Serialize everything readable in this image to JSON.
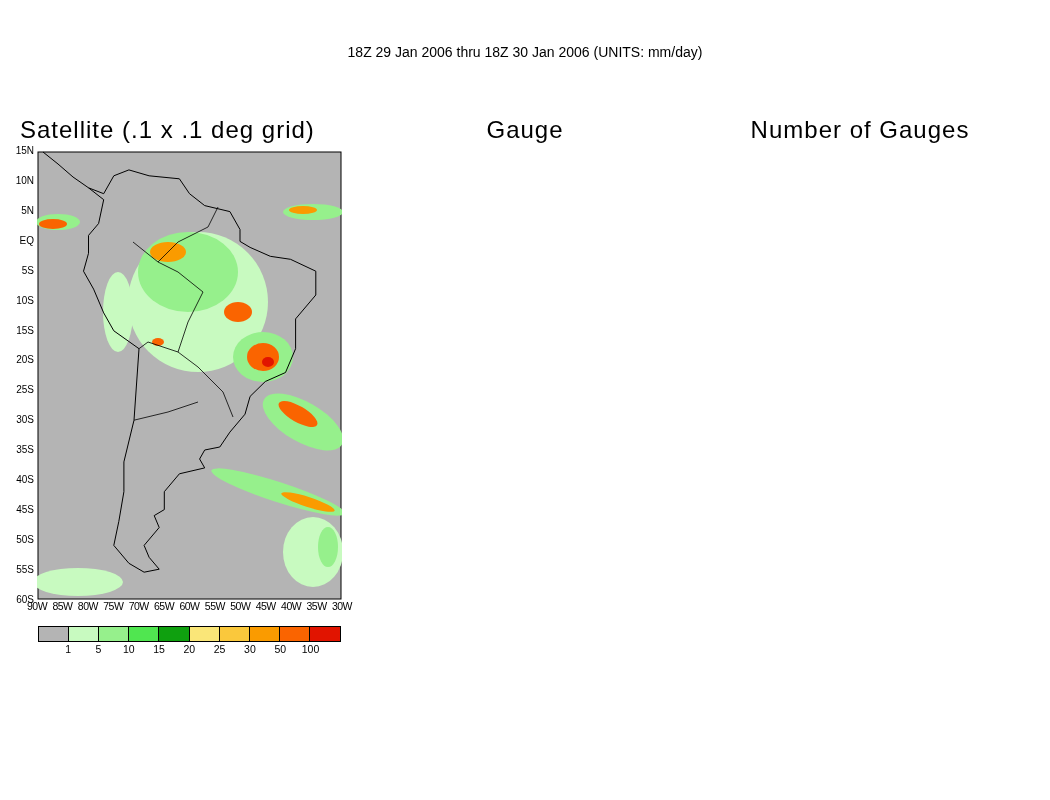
{
  "header": "18Z 29 Jan 2006 thru 18Z 30 Jan 2006 (UNITS: mm/day)",
  "panels": [
    {
      "title": "Satellite (.1 x .1 deg grid)"
    },
    {
      "title": "Gauge"
    },
    {
      "title": "Number of Gauges"
    }
  ],
  "map": {
    "y_ticks": [
      "15N",
      "10N",
      "5N",
      "EQ",
      "5S",
      "10S",
      "15S",
      "20S",
      "25S",
      "30S",
      "35S",
      "40S",
      "45S",
      "50S",
      "55S",
      "60S"
    ],
    "x_ticks": [
      "90W",
      "85W",
      "80W",
      "75W",
      "70W",
      "65W",
      "60W",
      "55W",
      "50W",
      "45W",
      "40W",
      "35W",
      "30W"
    ]
  },
  "legend": {
    "swatches": [
      {
        "color": "#b4b4b4"
      },
      {
        "color": "#c8fac0"
      },
      {
        "color": "#96f08c"
      },
      {
        "color": "#50e650"
      },
      {
        "color": "#0fa00f"
      },
      {
        "color": "#fae678"
      },
      {
        "color": "#fac83c"
      },
      {
        "color": "#fa9b00"
      },
      {
        "color": "#fa6400"
      },
      {
        "color": "#e11400"
      }
    ],
    "labels": [
      "1",
      "5",
      "10",
      "15",
      "20",
      "25",
      "30",
      "50",
      "100"
    ]
  }
}
